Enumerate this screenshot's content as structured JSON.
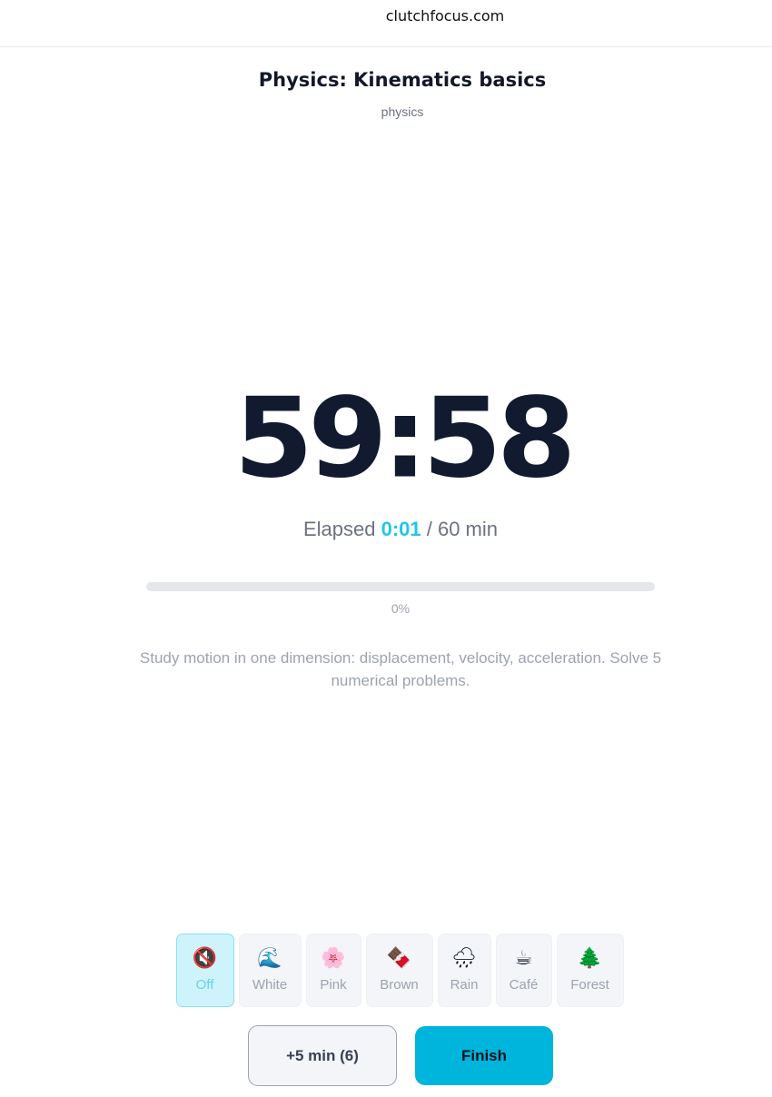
{
  "browser": {
    "url": "clutchfocus.com"
  },
  "session": {
    "title": "Physics: Kinematics basics",
    "subject": "physics",
    "timer": "59:58",
    "elapsed_prefix": "Elapsed ",
    "elapsed_value": "0:01",
    "elapsed_suffix": " / 60 min",
    "progress_percent": 0,
    "progress_label": "0%",
    "description": "Study motion in one dimension: displacement, velocity, acceleration. Solve 5 numerical problems."
  },
  "sounds": [
    {
      "label": "Off",
      "icon": "muted-speaker-icon",
      "glyph": "🔇",
      "active": true
    },
    {
      "label": "White",
      "icon": "wave-icon",
      "glyph": "🌊",
      "active": false
    },
    {
      "label": "Pink",
      "icon": "pink-flower-icon",
      "glyph": "🌸",
      "active": false
    },
    {
      "label": "Brown",
      "icon": "chocolate-bar-icon",
      "glyph": "🍫",
      "active": false
    },
    {
      "label": "Rain",
      "icon": "rain-cloud-icon",
      "glyph": "🌧",
      "active": false
    },
    {
      "label": "Café",
      "icon": "coffee-cup-icon",
      "glyph": "☕",
      "active": false
    },
    {
      "label": "Forest",
      "icon": "evergreen-tree-icon",
      "glyph": "🌲",
      "active": false
    }
  ],
  "actions": {
    "extend_label": "+5 min (6)",
    "finish_label": "Finish"
  },
  "colors": {
    "accent": "#22c6ea",
    "finish_button": "#00b5dc",
    "timer_text": "#111a2e"
  }
}
